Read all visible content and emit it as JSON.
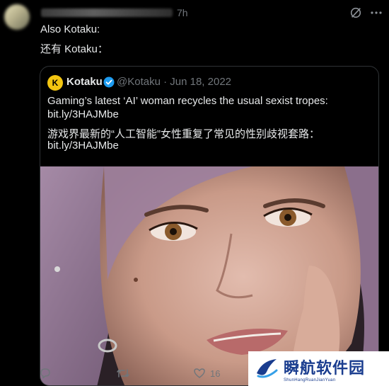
{
  "tweet": {
    "time": "7h",
    "line_en": "Also Kotaku:",
    "line_cn": "还有 Kotaku："
  },
  "quoted": {
    "logo_letter": "K",
    "author": "Kotaku",
    "meta": "@Kotaku · Jun 18, 2022",
    "text_en_1": "Gaming’s latest ‘AI’ woman recycles the usual sexist tropes:",
    "text_en_2": "bit.ly/3HAJMbe",
    "text_cn_1": "游戏界最新的“人工智能”女性重复了常见的性别歧视套路：",
    "text_cn_2": "bit.ly/3HAJMbe",
    "brand_color": "#f3c511"
  },
  "actions": {
    "likes": "16"
  },
  "watermark": {
    "cn": "瞬航软件园",
    "en": "ShunHangRuanJianYuan"
  },
  "icons": [
    "grok-icon",
    "more-icon",
    "verified-icon",
    "reply-icon",
    "retweet-icon",
    "like-icon"
  ]
}
